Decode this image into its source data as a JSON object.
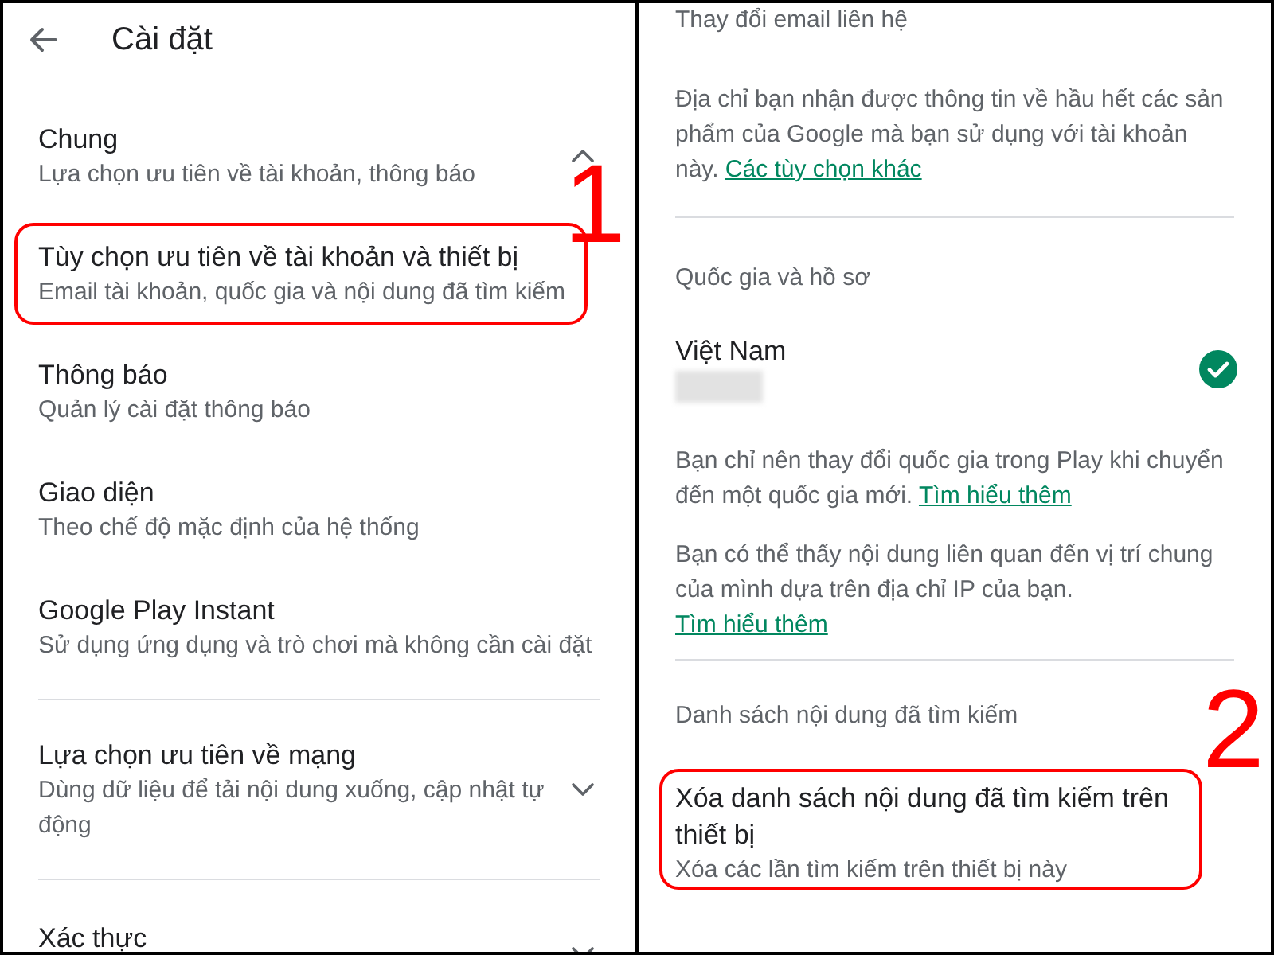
{
  "settings": {
    "title": "Cài đặt",
    "blocks": [
      {
        "kind": "group",
        "title": "Chung",
        "subtitle": "Lựa chọn ưu tiên về tài khoản, thông báo",
        "expanded": true
      },
      {
        "kind": "item",
        "title": "Tùy chọn ưu tiên về tài khoản và thiết bị",
        "subtitle": "Email tài khoản, quốc gia và nội dung đã tìm kiếm",
        "highlighted": true,
        "callout": "1"
      },
      {
        "kind": "item",
        "title": "Thông báo",
        "subtitle": "Quản lý cài đặt thông báo",
        "highlighted": false
      },
      {
        "kind": "item",
        "title": "Giao diện",
        "subtitle": "Theo chế độ mặc định của hệ thống",
        "highlighted": false
      },
      {
        "kind": "item",
        "title": "Google Play Instant",
        "subtitle": "Sử dụng ứng dụng và trò chơi mà không cần cài đặt",
        "highlighted": false
      },
      {
        "kind": "divider"
      },
      {
        "kind": "group",
        "title": "Lựa chọn ưu tiên về mạng",
        "subtitle": "Dùng dữ liệu để tải nội dung xuống, cập nhật tự động",
        "expanded": false
      },
      {
        "kind": "divider"
      },
      {
        "kind": "group",
        "title": "Xác thực",
        "expanded": false
      }
    ]
  },
  "account_panel": {
    "blocks": [
      {
        "kind": "note",
        "text": "Thay đổi email liên hệ"
      },
      {
        "kind": "paragraph",
        "text": "Địa chỉ bạn nhận được thông tin về hầu hết các sản phẩm của Google mà bạn sử dụng với tài khoản này.",
        "link": "Các tùy chọn khác"
      },
      {
        "kind": "divider"
      },
      {
        "kind": "header",
        "text": "Quốc gia và hồ sơ"
      },
      {
        "kind": "country",
        "title": "Việt Nam",
        "detail_hidden": true,
        "selected": true
      },
      {
        "kind": "paragraph",
        "text": "Bạn chỉ nên thay đổi quốc gia trong Play khi chuyển đến một quốc gia mới.",
        "link": "Tìm hiểu thêm"
      },
      {
        "kind": "paragraph",
        "text": "Bạn có thể thấy nội dung liên quan đến vị trí chung của mình dựa trên địa chỉ IP của bạn.",
        "link": "Tìm hiểu thêm"
      },
      {
        "kind": "divider"
      },
      {
        "kind": "header",
        "text": "Danh sách nội dung đã tìm kiếm"
      },
      {
        "kind": "item",
        "title": "Xóa danh sách nội dung đã tìm kiếm trên thiết bị",
        "subtitle": "Xóa các lần tìm kiếm trên thiết bị này",
        "highlighted": true,
        "callout": "2"
      }
    ]
  }
}
